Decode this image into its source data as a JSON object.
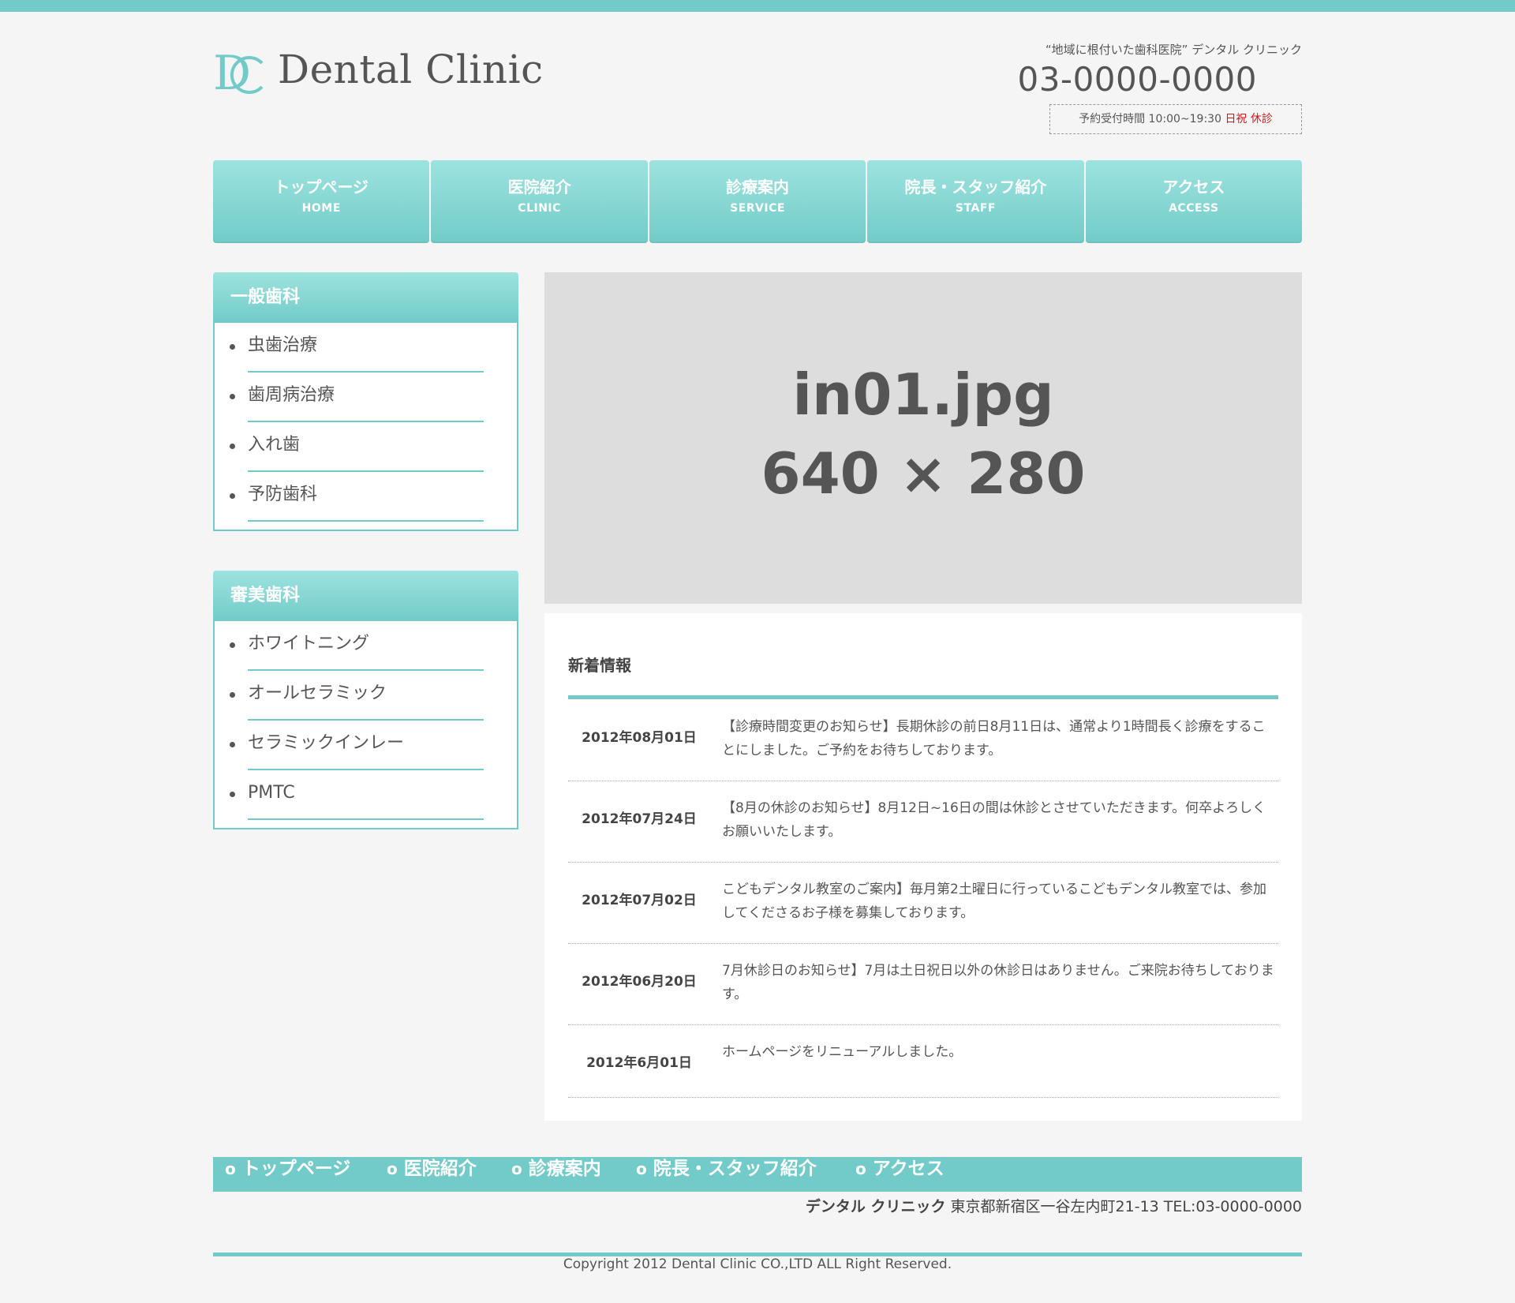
{
  "header": {
    "logo_text": "Dental Clinic",
    "tagline": "“地域に根付いた歯科医院” デンタル クリニック",
    "phone": "03-0000-0000",
    "hours_label": "予約受付時間 10:00~19:30",
    "hours_closed": "日祝 休診"
  },
  "nav": [
    {
      "jp": "トップページ",
      "en": "HOME"
    },
    {
      "jp": "医院紹介",
      "en": "CLINIC"
    },
    {
      "jp": "診療案内",
      "en": "SERVICE"
    },
    {
      "jp": "院長・スタッフ紹介",
      "en": "STAFF"
    },
    {
      "jp": "アクセス",
      "en": "ACCESS"
    }
  ],
  "sidebar": [
    {
      "title": "一般歯科",
      "items": [
        "虫歯治療",
        "歯周病治療",
        "入れ歯",
        "予防歯科"
      ]
    },
    {
      "title": "審美歯科",
      "items": [
        "ホワイトニング",
        "オールセラミック",
        "セラミックインレー",
        "PMTC"
      ]
    }
  ],
  "hero": {
    "line1": "in01.jpg",
    "line2": "640 × 280"
  },
  "news": {
    "title": "新着情報",
    "items": [
      {
        "date": "2012年08月01日",
        "text": "【診療時間変更のお知らせ】長期休診の前日8月11日は、通常より1時間長く診療をすることにしました。ご予約をお待ちしております。"
      },
      {
        "date": "2012年07月24日",
        "text": "【8月の休診のお知らせ】8月12日~16日の間は休診とさせていただきます。何卒よろしくお願いいたします。"
      },
      {
        "date": "2012年07月02日",
        "text": "こどもデンタル教室のご案内】毎月第2土曜日に行っているこどもデンタル教室では、参加してくださるお子様を募集しております。"
      },
      {
        "date": "2012年06月20日",
        "text": "7月休診日のお知らせ】7月は土日祝日以外の休診日はありません。ご来院お待ちしております。"
      },
      {
        "date": "2012年6月01日",
        "text": "ホームページをリニューアルしました。"
      }
    ]
  },
  "footer": {
    "bullet": "o",
    "nav": [
      "トップページ",
      "医院紹介",
      "診療案内",
      "院長・スタッフ紹介",
      "アクセス"
    ],
    "clinic_name": "デンタル クリニック",
    "address": "東京都新宿区一谷左内町21-13 TEL:03-0000-0000",
    "copyright": "Copyright 2012 Dental Clinic CO.,LTD ALL Right Reserved."
  },
  "colors": {
    "accent": "#72cbc8",
    "closed": "#d21c1c"
  }
}
